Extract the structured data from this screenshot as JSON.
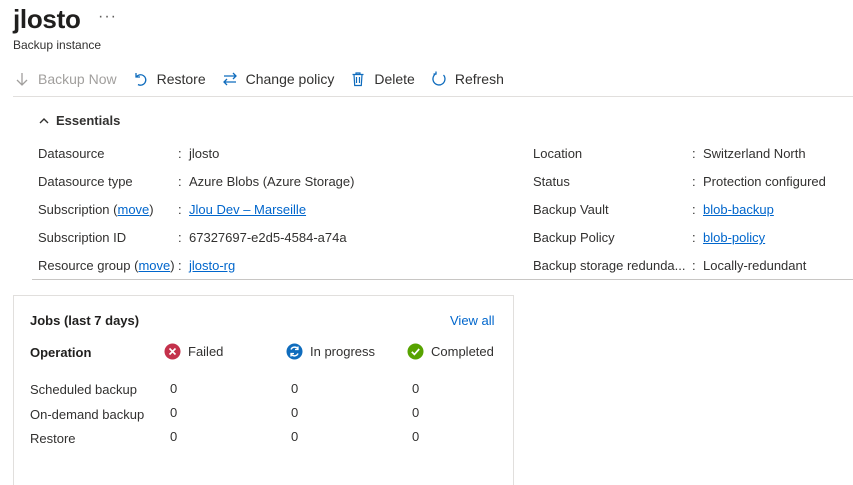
{
  "header": {
    "title": "jlosto",
    "more": "···",
    "subtitle": "Backup instance"
  },
  "toolbar": {
    "backup_now": "Backup Now",
    "restore": "Restore",
    "change_policy": "Change policy",
    "delete": "Delete",
    "refresh": "Refresh"
  },
  "essentials": {
    "label": "Essentials",
    "datasource": {
      "label": "Datasource",
      "value": "jlosto"
    },
    "datasource_type": {
      "label": "Datasource type",
      "value": "Azure Blobs (Azure Storage)"
    },
    "subscription": {
      "label": "Subscription",
      "move": "move",
      "value": "Jlou Dev – Marseille"
    },
    "subscription_id": {
      "label": "Subscription ID",
      "value": "67327697-e2d5-4584-a74a"
    },
    "resource_group": {
      "label": "Resource group",
      "move": "move",
      "value": "jlosto-rg"
    },
    "location": {
      "label": "Location",
      "value": "Switzerland North"
    },
    "status": {
      "label": "Status",
      "value": "Protection configured"
    },
    "backup_vault": {
      "label": "Backup Vault",
      "value": "blob-backup"
    },
    "backup_policy": {
      "label": "Backup Policy",
      "value": "blob-policy"
    },
    "redundancy": {
      "label": "Backup storage redunda...",
      "value": "Locally-redundant"
    },
    "colon": ":"
  },
  "jobs": {
    "title": "Jobs (last 7 days)",
    "view_all": "View all",
    "operation_header": "Operation",
    "failed_header": "Failed",
    "inprogress_header": "In progress",
    "completed_header": "Completed",
    "rows": [
      {
        "name": "Scheduled backup",
        "failed": "0",
        "inprogress": "0",
        "completed": "0"
      },
      {
        "name": "On-demand backup",
        "failed": "0",
        "inprogress": "0",
        "completed": "0"
      },
      {
        "name": "Restore",
        "failed": "0",
        "inprogress": "0",
        "completed": "0"
      }
    ]
  },
  "colors": {
    "accent": "#0066cc",
    "failed": "#c4314b",
    "inprogress": "#0f6cbd",
    "completed": "#57a300"
  }
}
